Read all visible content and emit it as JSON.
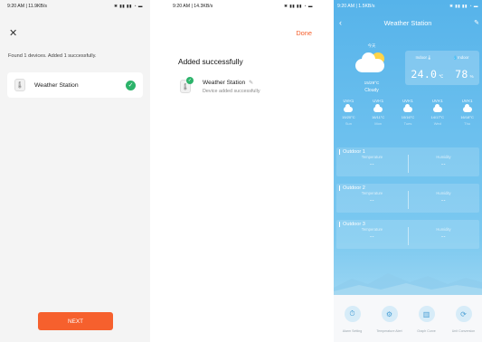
{
  "screen1": {
    "status": {
      "time": "9:20 AM | 11.9KB/s",
      "icons": "✱ ▮▮ ▮▮ ◔ ▬"
    },
    "close_glyph": "✕",
    "summary": "Found 1 devices. Added 1 successfully.",
    "device": {
      "name": "Weather Station",
      "icon": "thermometer-icon",
      "check": "✓"
    },
    "next_label": "NEXT"
  },
  "screen2": {
    "status": {
      "time": "9:20 AM | 14.3KB/s",
      "icons": "✱ ▮▮ ▮▮ ◔ ▬"
    },
    "done_label": "Done",
    "title": "Added successfully",
    "device": {
      "name": "Weather Station",
      "subtitle": "Device added successfully",
      "icon": "thermometer-icon",
      "edit_glyph": "✎",
      "check": "✓"
    }
  },
  "screen3": {
    "status": {
      "time": "9:20 AM | 1.5KB/s",
      "icons": "✱ ▮▮ ▮▮ ◔ ▬"
    },
    "nav": {
      "back": "‹",
      "title": "Weather Station",
      "edit": "✎"
    },
    "current": {
      "label": "今天",
      "range": "15/29°C",
      "condition": "Cloudy"
    },
    "indoor": {
      "temp_label": "Indoor🌡",
      "hum_label": "💧Indoor",
      "temp": "24.0",
      "temp_unit": "℃",
      "humidity": "78",
      "hum_unit": "%"
    },
    "forecast": [
      {
        "uv": "UVI<1",
        "range": "15/20°C",
        "day": "Sun"
      },
      {
        "uv": "UVI<1",
        "range": "16/11°C",
        "day": "Mon"
      },
      {
        "uv": "UVI<1",
        "range": "10/16°C",
        "day": "Tues"
      },
      {
        "uv": "UVI<1",
        "range": "14/17°C",
        "day": "Wed"
      },
      {
        "uv": "UVI<1",
        "range": "16/18°C",
        "day": "Thu"
      }
    ],
    "outdoor": [
      {
        "title": "Outdoor 1",
        "temp_label": "Temperature",
        "temp": "--",
        "hum_label": "Humidity",
        "hum": "--"
      },
      {
        "title": "Outdoor 2",
        "temp_label": "Temperature",
        "temp": "--",
        "hum_label": "Humidity",
        "hum": "--"
      },
      {
        "title": "Outdoor 3",
        "temp_label": "Temperature",
        "temp": "--",
        "hum_label": "Humidity",
        "hum": "--"
      }
    ],
    "tools": [
      {
        "label": "Alarm Setting",
        "icon": "alarm-clock-icon",
        "glyph": "⏱"
      },
      {
        "label": "Temperature Alert",
        "icon": "gear-icon",
        "glyph": "⚙"
      },
      {
        "label": "Graph Curve",
        "icon": "graph-icon",
        "glyph": "▥"
      },
      {
        "label": "Unit Conversion",
        "icon": "refresh-icon",
        "glyph": "⟳"
      }
    ]
  },
  "colors": {
    "accent": "#f6602d",
    "success": "#2cb36a",
    "sky": "#56b3ea"
  }
}
